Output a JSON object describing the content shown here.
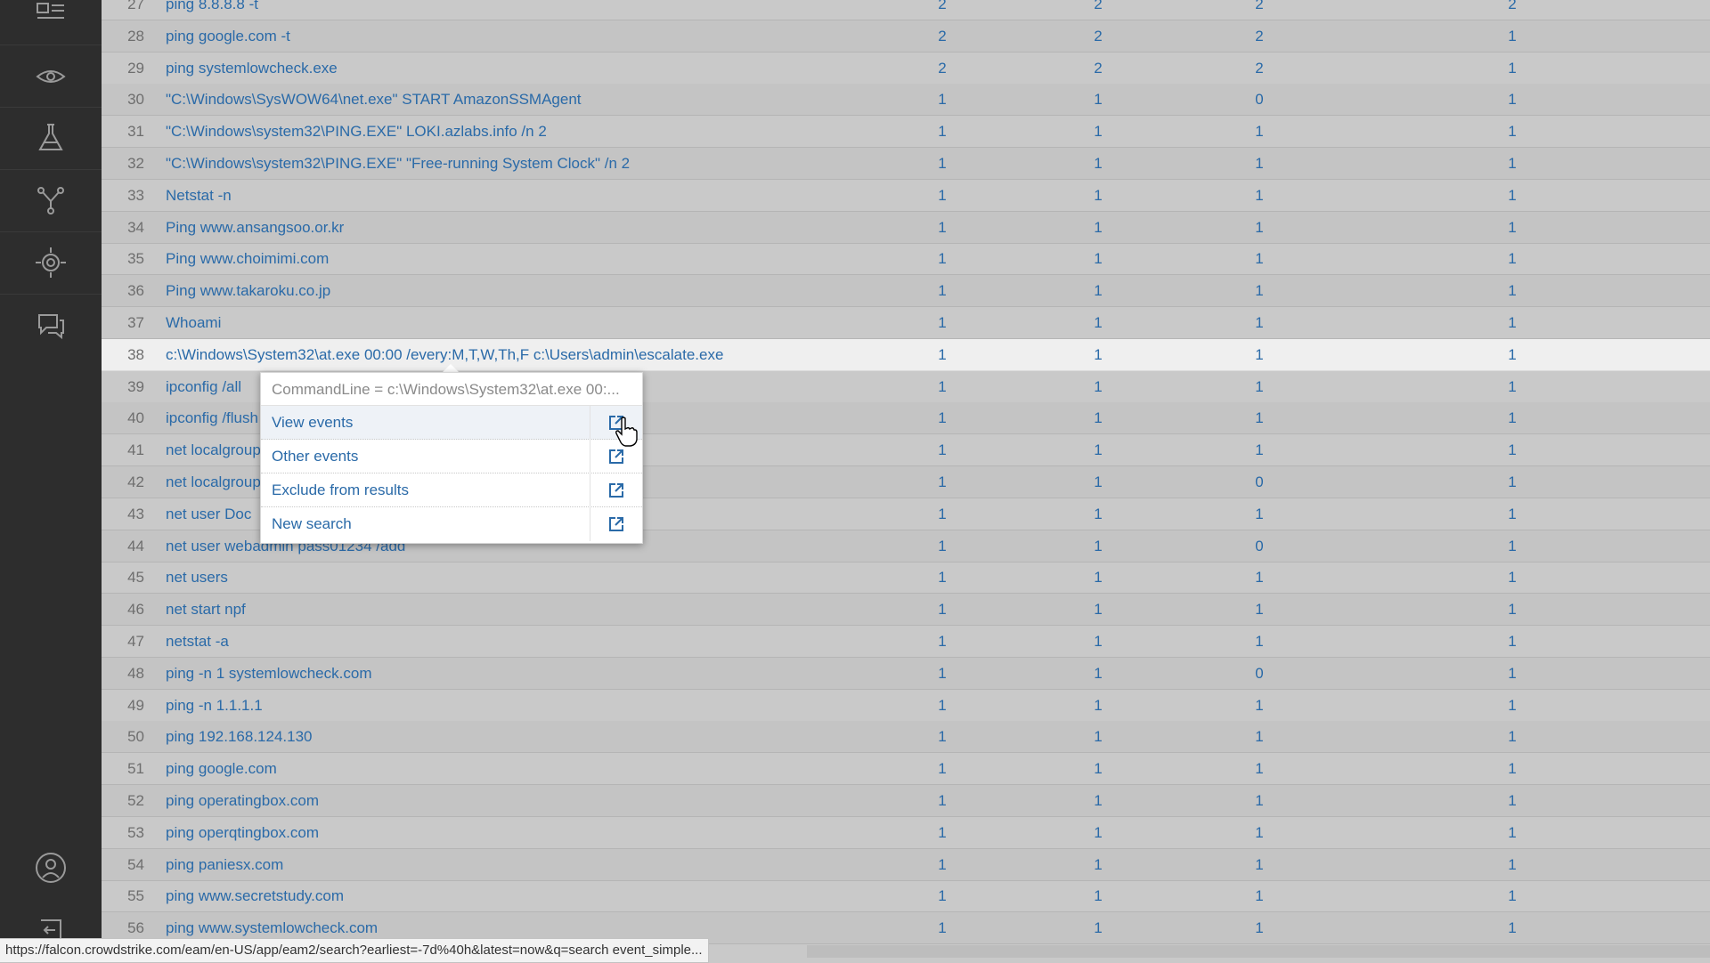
{
  "rail": {
    "icons": [
      "dashboard-icon",
      "eye-icon",
      "flask-icon",
      "graph-icon",
      "investigate-icon",
      "chat-icon",
      "user-icon",
      "collapse-icon"
    ]
  },
  "table": {
    "rows": [
      {
        "num": "27",
        "cmd": "ping 8.8.8.8 -t",
        "v1": "2",
        "v2": "2",
        "v3": "2",
        "v4": "2"
      },
      {
        "num": "28",
        "cmd": "ping google.com -t",
        "v1": "2",
        "v2": "2",
        "v3": "2",
        "v4": "1"
      },
      {
        "num": "29",
        "cmd": "ping systemlowcheck.exe",
        "v1": "2",
        "v2": "2",
        "v3": "2",
        "v4": "1"
      },
      {
        "num": "30",
        "cmd": "\"C:\\Windows\\SysWOW64\\net.exe\" START AmazonSSMAgent",
        "v1": "1",
        "v2": "1",
        "v3": "0",
        "v4": "1"
      },
      {
        "num": "31",
        "cmd": "\"C:\\Windows\\system32\\PING.EXE\" LOKI.azlabs.info /n 2",
        "v1": "1",
        "v2": "1",
        "v3": "1",
        "v4": "1"
      },
      {
        "num": "32",
        "cmd": "\"C:\\Windows\\system32\\PING.EXE\" \"Free-running System Clock\" /n 2",
        "v1": "1",
        "v2": "1",
        "v3": "1",
        "v4": "1"
      },
      {
        "num": "33",
        "cmd": "Netstat -n",
        "v1": "1",
        "v2": "1",
        "v3": "1",
        "v4": "1"
      },
      {
        "num": "34",
        "cmd": "Ping www.ansangsoo.or.kr",
        "v1": "1",
        "v2": "1",
        "v3": "1",
        "v4": "1"
      },
      {
        "num": "35",
        "cmd": "Ping www.choimimi.com",
        "v1": "1",
        "v2": "1",
        "v3": "1",
        "v4": "1"
      },
      {
        "num": "36",
        "cmd": "Ping www.takaroku.co.jp",
        "v1": "1",
        "v2": "1",
        "v3": "1",
        "v4": "1"
      },
      {
        "num": "37",
        "cmd": "Whoami",
        "v1": "1",
        "v2": "1",
        "v3": "1",
        "v4": "1"
      },
      {
        "num": "38",
        "cmd": "c:\\Windows\\System32\\at.exe 00:00 /every:M,T,W,Th,F c:\\Users\\admin\\escalate.exe",
        "v1": "1",
        "v2": "1",
        "v3": "1",
        "v4": "1"
      },
      {
        "num": "39",
        "cmd": "ipconfig /all",
        "v1": "1",
        "v2": "1",
        "v3": "1",
        "v4": "1"
      },
      {
        "num": "40",
        "cmd": "ipconfig /flush",
        "v1": "1",
        "v2": "1",
        "v3": "1",
        "v4": "1"
      },
      {
        "num": "41",
        "cmd": "net localgroup",
        "v1": "1",
        "v2": "1",
        "v3": "1",
        "v4": "1"
      },
      {
        "num": "42",
        "cmd": "net localgroup",
        "v1": "1",
        "v2": "1",
        "v3": "0",
        "v4": "1"
      },
      {
        "num": "43",
        "cmd": "net user Doc",
        "v1": "1",
        "v2": "1",
        "v3": "1",
        "v4": "1"
      },
      {
        "num": "44",
        "cmd": "net user webadmin pass01234 /add",
        "v1": "1",
        "v2": "1",
        "v3": "0",
        "v4": "1"
      },
      {
        "num": "45",
        "cmd": "net users",
        "v1": "1",
        "v2": "1",
        "v3": "1",
        "v4": "1"
      },
      {
        "num": "46",
        "cmd": "net start npf",
        "v1": "1",
        "v2": "1",
        "v3": "1",
        "v4": "1"
      },
      {
        "num": "47",
        "cmd": "netstat -a",
        "v1": "1",
        "v2": "1",
        "v3": "1",
        "v4": "1"
      },
      {
        "num": "48",
        "cmd": "ping -n 1 systemlowcheck.com",
        "v1": "1",
        "v2": "1",
        "v3": "0",
        "v4": "1"
      },
      {
        "num": "49",
        "cmd": "ping -n 1.1.1.1",
        "v1": "1",
        "v2": "1",
        "v3": "1",
        "v4": "1"
      },
      {
        "num": "50",
        "cmd": "ping 192.168.124.130",
        "v1": "1",
        "v2": "1",
        "v3": "1",
        "v4": "1"
      },
      {
        "num": "51",
        "cmd": "ping google.com",
        "v1": "1",
        "v2": "1",
        "v3": "1",
        "v4": "1"
      },
      {
        "num": "52",
        "cmd": "ping operatingbox.com",
        "v1": "1",
        "v2": "1",
        "v3": "1",
        "v4": "1"
      },
      {
        "num": "53",
        "cmd": "ping operqtingbox.com",
        "v1": "1",
        "v2": "1",
        "v3": "1",
        "v4": "1"
      },
      {
        "num": "54",
        "cmd": "ping paniesx.com",
        "v1": "1",
        "v2": "1",
        "v3": "1",
        "v4": "1"
      },
      {
        "num": "55",
        "cmd": "ping www.secretstudy.com",
        "v1": "1",
        "v2": "1",
        "v3": "1",
        "v4": "1"
      },
      {
        "num": "56",
        "cmd": "ping www.systemlowcheck.com",
        "v1": "1",
        "v2": "1",
        "v3": "1",
        "v4": "1"
      }
    ]
  },
  "popup": {
    "header": "CommandLine = c:\\Windows\\System32\\at.exe 00:...",
    "items": [
      {
        "label": "View events",
        "icon": "external-link-icon"
      },
      {
        "label": "Other events",
        "icon": "external-link-icon"
      },
      {
        "label": "Exclude from results",
        "icon": "external-link-icon"
      },
      {
        "label": "New search",
        "icon": "external-link-icon"
      }
    ]
  },
  "statusbar": {
    "url": "https://falcon.crowdstrike.com/eam/en-US/app/eam2/search?earliest=-7d%40h&latest=now&q=search event_simple..."
  },
  "colors": {
    "link": "#2a6aa8",
    "rail": "#2d2d2d",
    "row_bg": "#c9c9c9",
    "row_highlight": "#efefef"
  }
}
